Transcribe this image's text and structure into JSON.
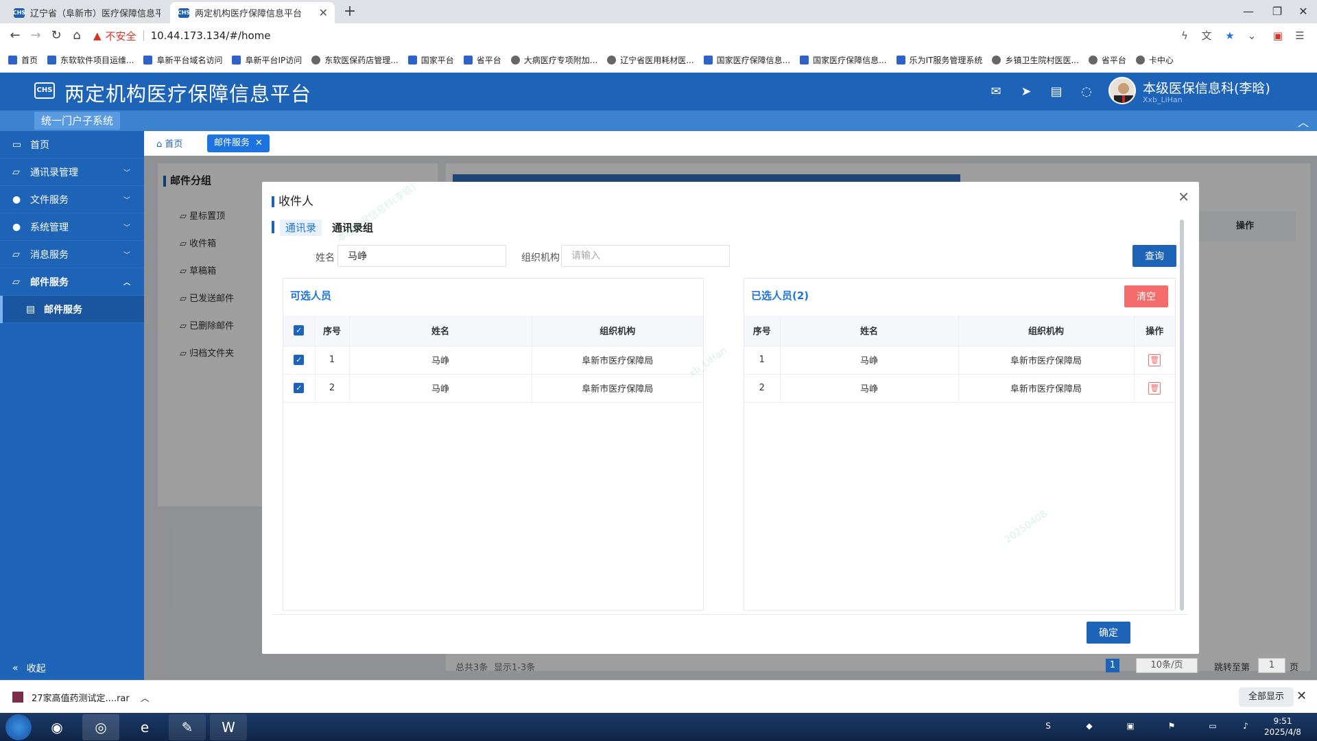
{
  "browser": {
    "tabs": [
      {
        "title": "辽宁省（阜新市）医疗保障信息平台",
        "active": false
      },
      {
        "title": "两定机构医疗保障信息平台",
        "active": true
      }
    ],
    "security_label": "不安全",
    "url": "10.44.173.134/#/home",
    "bookmarks": [
      "首页",
      "东软软件项目运维...",
      "阜新平台域名访问",
      "阜新平台IP访问",
      "东软医保药店管理...",
      "国家平台",
      "省平台",
      "大病医疗专项附加...",
      "辽宁省医用耗材医...",
      "国家医疗保障信息...",
      "国家医疗保障信息...",
      "乐为IT服务管理系统",
      "乡镇卫生院村医医...",
      "省平台",
      "卡中心"
    ]
  },
  "app": {
    "logo_text": "CHS",
    "title": "两定机构医疗保障信息平台",
    "subsystem": "统一门户子系统",
    "user_name": "本级医保信息科(李晗)",
    "user_id": "Xxb_LiHan",
    "header_icons": [
      "mail-icon",
      "send-icon",
      "document-icon",
      "chat-icon"
    ]
  },
  "sidebar": {
    "items": [
      {
        "label": "首页",
        "icon": "monitor-icon"
      },
      {
        "label": "通讯录管理",
        "icon": "folder-icon"
      },
      {
        "label": "文件服务",
        "icon": "user-icon"
      },
      {
        "label": "系统管理",
        "icon": "user-icon"
      },
      {
        "label": "消息服务",
        "icon": "folder-icon"
      },
      {
        "label": "邮件服务",
        "icon": "folder-icon"
      },
      {
        "label": "邮件服务",
        "icon": "document-icon"
      }
    ],
    "collapse_label": "收起"
  },
  "page_tabs": {
    "home": "首页",
    "current": "邮件服务"
  },
  "mail_groups": {
    "title": "邮件分组",
    "items": [
      "星标置顶",
      "收件箱",
      "草稿箱",
      "已发送邮件",
      "已删除邮件",
      "归档文件夹"
    ]
  },
  "background": {
    "op_header": "操作",
    "pagination": {
      "total": "总共3条",
      "range": "显示1-3条",
      "page": "1",
      "page_size": "10条/页",
      "jump_label": "跳转至第",
      "jump_value": "1",
      "page_suffix": "页"
    }
  },
  "modal": {
    "title": "收件人",
    "tabs": [
      "通讯录",
      "通讯录组"
    ],
    "name_label": "姓名",
    "name_value": "马峥",
    "org_label": "组织机构",
    "org_placeholder": "请输入",
    "query_button": "查询",
    "available": {
      "title": "可选人员",
      "columns": [
        "序号",
        "姓名",
        "组织机构"
      ],
      "rows": [
        {
          "no": "1",
          "name": "马峥",
          "org": "阜新市医疗保障局"
        },
        {
          "no": "2",
          "name": "马峥",
          "org": "阜新市医疗保障局"
        }
      ]
    },
    "selected": {
      "title": "已选人员(2)",
      "clear_button": "清空",
      "columns": [
        "序号",
        "姓名",
        "组织机构",
        "操作"
      ],
      "rows": [
        {
          "no": "1",
          "name": "马峥",
          "org": "阜新市医疗保障局"
        },
        {
          "no": "2",
          "name": "马峥",
          "org": "阜新市医疗保障局"
        }
      ]
    },
    "confirm_button": "确定"
  },
  "downloads": {
    "file": "27家高值药测试定....rar",
    "show_all": "全部显示"
  },
  "taskbar": {
    "time": "9:51",
    "date": "2025/4/8"
  },
  "watermark": {
    "line1": "本级医保信息科(李晗)",
    "line2": "xb_LiHan",
    "line3": "20250408"
  }
}
